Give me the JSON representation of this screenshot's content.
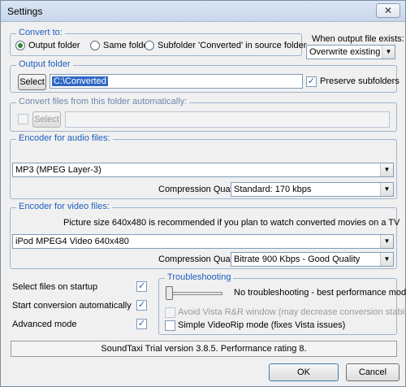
{
  "window": {
    "title": "Settings",
    "close_glyph": "✕"
  },
  "convert_to": {
    "legend": "Convert to:",
    "options": [
      "Output folder",
      "Same folder",
      "Subfolder 'Converted' in source folder"
    ],
    "selected": "Output folder"
  },
  "output_exists": {
    "label": "When output file exists:",
    "value": "Overwrite existing file"
  },
  "output_folder": {
    "legend": "Output folder",
    "select_label": "Select",
    "path": "C:\\Converted",
    "preserve_label": "Preserve subfolders",
    "preserve_checked": true
  },
  "auto_convert": {
    "legend": "Convert files from this folder automatically:",
    "select_label": "Select",
    "path": ""
  },
  "audio": {
    "legend": "Encoder for audio files:",
    "encoder": "MP3 (MPEG Layer-3)",
    "quality_label": "Compression Quality",
    "quality": "Standard: 170 kbps"
  },
  "video": {
    "legend": "Encoder for video files:",
    "hint": "Picture size 640x480 is recommended if you plan to watch converted movies on a TV",
    "encoder": "iPod MPEG4 Video 640x480",
    "quality_label": "Compression Quality",
    "quality": "Bitrate 900 Kbps - Good Quality"
  },
  "options": {
    "select_on_startup": "Select files on startup",
    "start_auto": "Start conversion automatically",
    "advanced_mode": "Advanced mode"
  },
  "troubleshooting": {
    "legend": "Troubleshooting",
    "level_text": "No troubleshooting - best performance mode.",
    "avoid_vista": "Avoid Vista R&R window (may decrease conversion stability!)",
    "simple_videorip": "Simple VideoRip mode (fixes Vista issues)",
    "slider_level": 0
  },
  "status": "SoundTaxi Trial version 3.8.5. Performance rating 8.",
  "buttons": {
    "ok": "OK",
    "cancel": "Cancel"
  },
  "icons": {
    "check": "✓",
    "dropdown": "▼"
  }
}
